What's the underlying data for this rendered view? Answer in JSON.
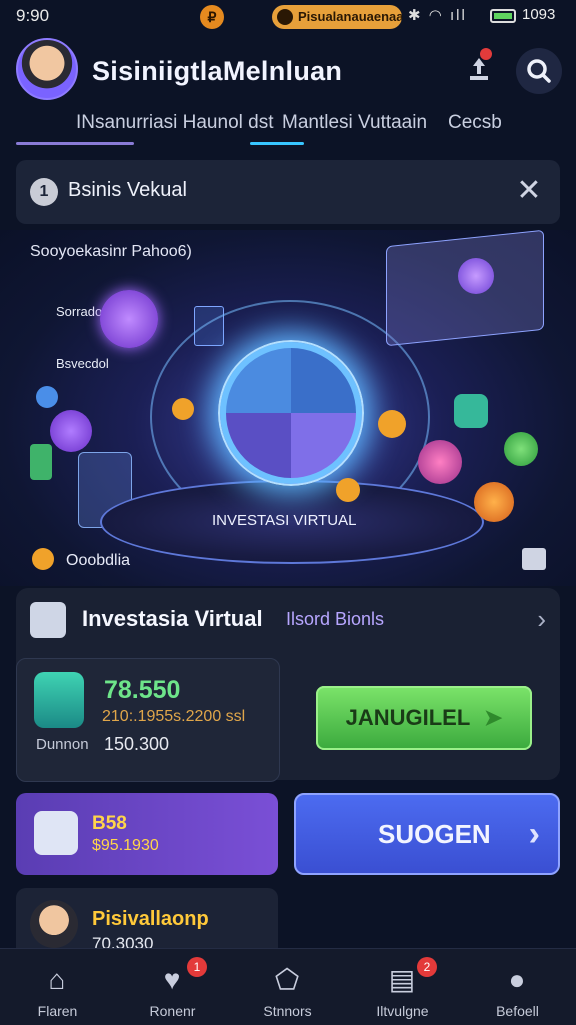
{
  "status_bar": {
    "time": "9:90",
    "pill_text": "Pisualanauaenaaa",
    "right_text": "1093"
  },
  "header": {
    "title": "SisiniigtlaMelnluan"
  },
  "tabs": [
    {
      "label": "INsanurriasi Haunol dst"
    },
    {
      "label": "Mantlesi Vuttaain"
    },
    {
      "label": "Cecsb"
    }
  ],
  "notice": {
    "text": "Bsinis Vekual"
  },
  "hero": {
    "top_label": "Sooyoekasinr Pahoo6)",
    "left_label_1": "Sorrado",
    "left_label_2": "Bsvecdol",
    "center_label": "INVESTASI VIRTUAL",
    "bottom_label": "Ooobdlia"
  },
  "invest": {
    "title": "Investasia Virtual",
    "subtitle": "Ilsord Bionls",
    "value_main": "78.550",
    "value_secondary": "210:.1955s.2200 ssl",
    "value_label": "Dunnon",
    "value_amount": "150.300",
    "cta_label": "JANUGILEL"
  },
  "promo": {
    "title": "B58",
    "amount": "$95.1930"
  },
  "blue_button": {
    "label": "SUOGEN"
  },
  "profile": {
    "name": "Pisivallaonp",
    "value": "70.3030"
  },
  "nav": [
    {
      "label": "Flaren",
      "icon": "home-icon"
    },
    {
      "label": "Ronenr",
      "icon": "heart-icon",
      "badge": "1"
    },
    {
      "label": "Stnnors",
      "icon": "tag-icon"
    },
    {
      "label": "Iltvulgne",
      "icon": "clipboard-icon",
      "badge": "2"
    },
    {
      "label": "Befoell",
      "icon": "user-icon"
    }
  ],
  "colors": {
    "accent_purple": "#7a4fd6",
    "accent_green": "#5ccf55",
    "accent_blue": "#4c6bf0",
    "background": "#0c1326"
  }
}
